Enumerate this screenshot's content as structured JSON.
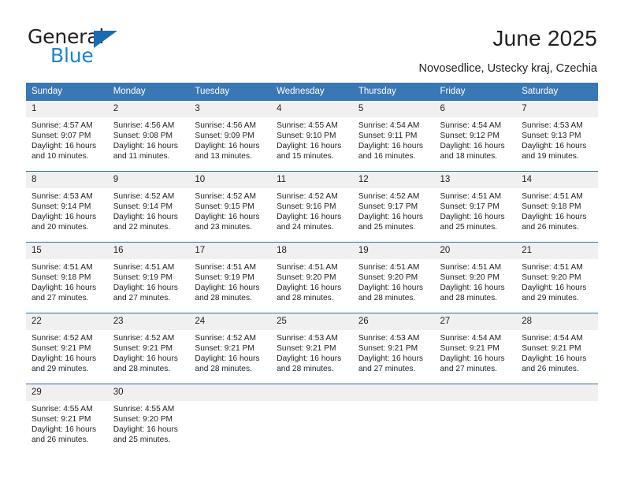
{
  "brand": {
    "name_top": "General",
    "name_bottom": "Blue",
    "logo_icon": "triangle-logo-icon",
    "accent_color": "#2083c8"
  },
  "header": {
    "title": "June 2025",
    "location": "Novosedlice, Ustecky kraj, Czechia"
  },
  "calendar": {
    "header_color": "#3a78b5",
    "weekdays": [
      "Sunday",
      "Monday",
      "Tuesday",
      "Wednesday",
      "Thursday",
      "Friday",
      "Saturday"
    ],
    "labels": {
      "sunrise": "Sunrise:",
      "sunset": "Sunset:",
      "daylight": "Daylight:"
    },
    "weeks": [
      [
        {
          "day": "1",
          "sunrise": "Sunrise: 4:57 AM",
          "sunset": "Sunset: 9:07 PM",
          "daylight_1": "Daylight: 16 hours",
          "daylight_2": "and 10 minutes."
        },
        {
          "day": "2",
          "sunrise": "Sunrise: 4:56 AM",
          "sunset": "Sunset: 9:08 PM",
          "daylight_1": "Daylight: 16 hours",
          "daylight_2": "and 11 minutes."
        },
        {
          "day": "3",
          "sunrise": "Sunrise: 4:56 AM",
          "sunset": "Sunset: 9:09 PM",
          "daylight_1": "Daylight: 16 hours",
          "daylight_2": "and 13 minutes."
        },
        {
          "day": "4",
          "sunrise": "Sunrise: 4:55 AM",
          "sunset": "Sunset: 9:10 PM",
          "daylight_1": "Daylight: 16 hours",
          "daylight_2": "and 15 minutes."
        },
        {
          "day": "5",
          "sunrise": "Sunrise: 4:54 AM",
          "sunset": "Sunset: 9:11 PM",
          "daylight_1": "Daylight: 16 hours",
          "daylight_2": "and 16 minutes."
        },
        {
          "day": "6",
          "sunrise": "Sunrise: 4:54 AM",
          "sunset": "Sunset: 9:12 PM",
          "daylight_1": "Daylight: 16 hours",
          "daylight_2": "and 18 minutes."
        },
        {
          "day": "7",
          "sunrise": "Sunrise: 4:53 AM",
          "sunset": "Sunset: 9:13 PM",
          "daylight_1": "Daylight: 16 hours",
          "daylight_2": "and 19 minutes."
        }
      ],
      [
        {
          "day": "8",
          "sunrise": "Sunrise: 4:53 AM",
          "sunset": "Sunset: 9:14 PM",
          "daylight_1": "Daylight: 16 hours",
          "daylight_2": "and 20 minutes."
        },
        {
          "day": "9",
          "sunrise": "Sunrise: 4:52 AM",
          "sunset": "Sunset: 9:14 PM",
          "daylight_1": "Daylight: 16 hours",
          "daylight_2": "and 22 minutes."
        },
        {
          "day": "10",
          "sunrise": "Sunrise: 4:52 AM",
          "sunset": "Sunset: 9:15 PM",
          "daylight_1": "Daylight: 16 hours",
          "daylight_2": "and 23 minutes."
        },
        {
          "day": "11",
          "sunrise": "Sunrise: 4:52 AM",
          "sunset": "Sunset: 9:16 PM",
          "daylight_1": "Daylight: 16 hours",
          "daylight_2": "and 24 minutes."
        },
        {
          "day": "12",
          "sunrise": "Sunrise: 4:52 AM",
          "sunset": "Sunset: 9:17 PM",
          "daylight_1": "Daylight: 16 hours",
          "daylight_2": "and 25 minutes."
        },
        {
          "day": "13",
          "sunrise": "Sunrise: 4:51 AM",
          "sunset": "Sunset: 9:17 PM",
          "daylight_1": "Daylight: 16 hours",
          "daylight_2": "and 25 minutes."
        },
        {
          "day": "14",
          "sunrise": "Sunrise: 4:51 AM",
          "sunset": "Sunset: 9:18 PM",
          "daylight_1": "Daylight: 16 hours",
          "daylight_2": "and 26 minutes."
        }
      ],
      [
        {
          "day": "15",
          "sunrise": "Sunrise: 4:51 AM",
          "sunset": "Sunset: 9:18 PM",
          "daylight_1": "Daylight: 16 hours",
          "daylight_2": "and 27 minutes."
        },
        {
          "day": "16",
          "sunrise": "Sunrise: 4:51 AM",
          "sunset": "Sunset: 9:19 PM",
          "daylight_1": "Daylight: 16 hours",
          "daylight_2": "and 27 minutes."
        },
        {
          "day": "17",
          "sunrise": "Sunrise: 4:51 AM",
          "sunset": "Sunset: 9:19 PM",
          "daylight_1": "Daylight: 16 hours",
          "daylight_2": "and 28 minutes."
        },
        {
          "day": "18",
          "sunrise": "Sunrise: 4:51 AM",
          "sunset": "Sunset: 9:20 PM",
          "daylight_1": "Daylight: 16 hours",
          "daylight_2": "and 28 minutes."
        },
        {
          "day": "19",
          "sunrise": "Sunrise: 4:51 AM",
          "sunset": "Sunset: 9:20 PM",
          "daylight_1": "Daylight: 16 hours",
          "daylight_2": "and 28 minutes."
        },
        {
          "day": "20",
          "sunrise": "Sunrise: 4:51 AM",
          "sunset": "Sunset: 9:20 PM",
          "daylight_1": "Daylight: 16 hours",
          "daylight_2": "and 28 minutes."
        },
        {
          "day": "21",
          "sunrise": "Sunrise: 4:51 AM",
          "sunset": "Sunset: 9:20 PM",
          "daylight_1": "Daylight: 16 hours",
          "daylight_2": "and 29 minutes."
        }
      ],
      [
        {
          "day": "22",
          "sunrise": "Sunrise: 4:52 AM",
          "sunset": "Sunset: 9:21 PM",
          "daylight_1": "Daylight: 16 hours",
          "daylight_2": "and 29 minutes."
        },
        {
          "day": "23",
          "sunrise": "Sunrise: 4:52 AM",
          "sunset": "Sunset: 9:21 PM",
          "daylight_1": "Daylight: 16 hours",
          "daylight_2": "and 28 minutes."
        },
        {
          "day": "24",
          "sunrise": "Sunrise: 4:52 AM",
          "sunset": "Sunset: 9:21 PM",
          "daylight_1": "Daylight: 16 hours",
          "daylight_2": "and 28 minutes."
        },
        {
          "day": "25",
          "sunrise": "Sunrise: 4:53 AM",
          "sunset": "Sunset: 9:21 PM",
          "daylight_1": "Daylight: 16 hours",
          "daylight_2": "and 28 minutes."
        },
        {
          "day": "26",
          "sunrise": "Sunrise: 4:53 AM",
          "sunset": "Sunset: 9:21 PM",
          "daylight_1": "Daylight: 16 hours",
          "daylight_2": "and 27 minutes."
        },
        {
          "day": "27",
          "sunrise": "Sunrise: 4:54 AM",
          "sunset": "Sunset: 9:21 PM",
          "daylight_1": "Daylight: 16 hours",
          "daylight_2": "and 27 minutes."
        },
        {
          "day": "28",
          "sunrise": "Sunrise: 4:54 AM",
          "sunset": "Sunset: 9:21 PM",
          "daylight_1": "Daylight: 16 hours",
          "daylight_2": "and 26 minutes."
        }
      ],
      [
        {
          "day": "29",
          "sunrise": "Sunrise: 4:55 AM",
          "sunset": "Sunset: 9:21 PM",
          "daylight_1": "Daylight: 16 hours",
          "daylight_2": "and 26 minutes."
        },
        {
          "day": "30",
          "sunrise": "Sunrise: 4:55 AM",
          "sunset": "Sunset: 9:20 PM",
          "daylight_1": "Daylight: 16 hours",
          "daylight_2": "and 25 minutes."
        },
        {
          "day": "",
          "sunrise": "",
          "sunset": "",
          "daylight_1": "",
          "daylight_2": ""
        },
        {
          "day": "",
          "sunrise": "",
          "sunset": "",
          "daylight_1": "",
          "daylight_2": ""
        },
        {
          "day": "",
          "sunrise": "",
          "sunset": "",
          "daylight_1": "",
          "daylight_2": ""
        },
        {
          "day": "",
          "sunrise": "",
          "sunset": "",
          "daylight_1": "",
          "daylight_2": ""
        },
        {
          "day": "",
          "sunrise": "",
          "sunset": "",
          "daylight_1": "",
          "daylight_2": ""
        }
      ]
    ]
  }
}
